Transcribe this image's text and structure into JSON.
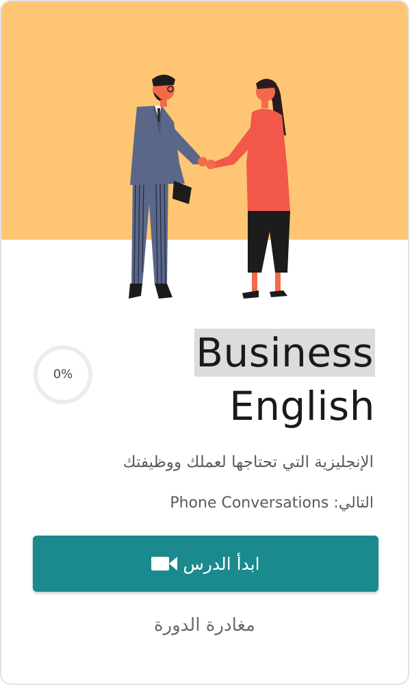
{
  "course": {
    "title_line1": "Business",
    "title_line2": "English",
    "progress_label": "0%",
    "progress": 0,
    "subtitle": "الإنجليزية التي تحتاجها لعملك ووظيفتك",
    "next_label": "التالي:",
    "next_lesson": "Phone Conversations"
  },
  "actions": {
    "start_label": "ابدأ الدرس",
    "start_icon": "video-camera-icon",
    "leave_label": "مغادرة الدورة"
  },
  "colors": {
    "hero_background": "#fec674",
    "button": "#1a8a8e"
  }
}
